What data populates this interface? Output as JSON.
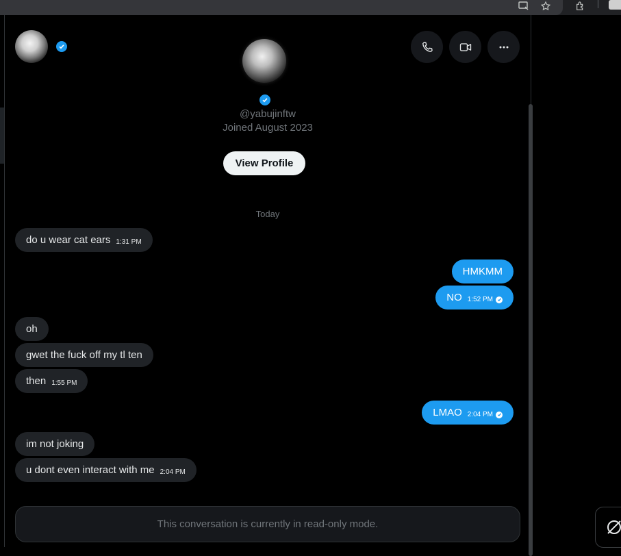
{
  "conversation": {
    "handle": "@yabujinftw",
    "joined": "Joined August 2023",
    "view_profile_label": "View Profile",
    "day_label": "Today",
    "messages": [
      {
        "text": "do u wear cat ears",
        "time": "1:31 PM"
      },
      {
        "text": "HMKMM"
      },
      {
        "text": "NO",
        "time": "1:52 PM"
      },
      {
        "text": "oh"
      },
      {
        "text": "gwet the fuck off my tl ten"
      },
      {
        "text": "then",
        "time": "1:55 PM"
      },
      {
        "text": "LMAO",
        "time": "2:04 PM"
      },
      {
        "text": "im not joking"
      },
      {
        "text": "u dont even interact with me",
        "time": "2:04 PM"
      }
    ],
    "readonly_notice": "This conversation is currently in read-only mode."
  },
  "icons": {
    "call": "phone-icon",
    "video": "video-icon",
    "more": "more-icon",
    "verified": "verified-badge-icon"
  },
  "colors": {
    "accent": "#1d9bf0",
    "incoming_bubble": "#202327",
    "background": "#000000"
  }
}
